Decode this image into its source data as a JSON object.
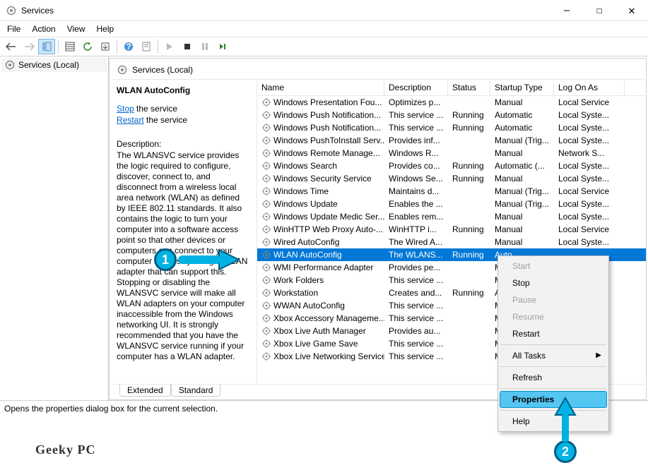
{
  "window": {
    "title": "Services"
  },
  "menubar": [
    "File",
    "Action",
    "View",
    "Help"
  ],
  "nav": {
    "root": "Services (Local)"
  },
  "detail_header": "Services (Local)",
  "selected_service": {
    "name": "WLAN AutoConfig",
    "actions": {
      "stop": "Stop",
      "stop_suffix": " the service",
      "restart": "Restart",
      "restart_suffix": " the service"
    },
    "desc_label": "Description:",
    "description": "The WLANSVC service provides the logic required to configure, discover, connect to, and disconnect from a wireless local area network (WLAN) as defined by IEEE 802.11 standards. It also contains the logic to turn your computer into a software access point so that other devices or computers can connect to your computer wirelessly using a WLAN adapter that can support this. Stopping or disabling the WLANSVC service will make all WLAN adapters on your computer inaccessible from the Windows networking UI. It is strongly recommended that you have the WLANSVC service running if your computer has a WLAN adapter."
  },
  "columns": {
    "name": "Name",
    "desc": "Description",
    "status": "Status",
    "start": "Startup Type",
    "logon": "Log On As"
  },
  "rows": [
    {
      "name": "Windows Presentation Fou...",
      "desc": "Optimizes p...",
      "status": "",
      "start": "Manual",
      "logon": "Local Service"
    },
    {
      "name": "Windows Push Notification...",
      "desc": "This service ...",
      "status": "Running",
      "start": "Automatic",
      "logon": "Local Syste..."
    },
    {
      "name": "Windows Push Notification...",
      "desc": "This service ...",
      "status": "Running",
      "start": "Automatic",
      "logon": "Local Syste..."
    },
    {
      "name": "Windows PushToInstall Serv...",
      "desc": "Provides inf...",
      "status": "",
      "start": "Manual (Trig...",
      "logon": "Local Syste..."
    },
    {
      "name": "Windows Remote Manage...",
      "desc": "Windows R...",
      "status": "",
      "start": "Manual",
      "logon": "Network S..."
    },
    {
      "name": "Windows Search",
      "desc": "Provides co...",
      "status": "Running",
      "start": "Automatic (...",
      "logon": "Local Syste..."
    },
    {
      "name": "Windows Security Service",
      "desc": "Windows Se...",
      "status": "Running",
      "start": "Manual",
      "logon": "Local Syste..."
    },
    {
      "name": "Windows Time",
      "desc": "Maintains d...",
      "status": "",
      "start": "Manual (Trig...",
      "logon": "Local Service"
    },
    {
      "name": "Windows Update",
      "desc": "Enables the ...",
      "status": "",
      "start": "Manual (Trig...",
      "logon": "Local Syste..."
    },
    {
      "name": "Windows Update Medic Ser...",
      "desc": "Enables rem...",
      "status": "",
      "start": "Manual",
      "logon": "Local Syste..."
    },
    {
      "name": "WinHTTP Web Proxy Auto-...",
      "desc": "WinHTTP i...",
      "status": "Running",
      "start": "Manual",
      "logon": "Local Service"
    },
    {
      "name": "Wired AutoConfig",
      "desc": "The Wired A...",
      "status": "",
      "start": "Manual",
      "logon": "Local Syste..."
    },
    {
      "name": "WLAN AutoConfig",
      "desc": "The WLANS...",
      "status": "Running",
      "start": "Auto",
      "logon": "",
      "selected": true
    },
    {
      "name": "WMI Performance Adapter",
      "desc": "Provides pe...",
      "status": "",
      "start": "Manu",
      "logon": ""
    },
    {
      "name": "Work Folders",
      "desc": "This service ...",
      "status": "",
      "start": "Manu",
      "logon": ""
    },
    {
      "name": "Workstation",
      "desc": "Creates and...",
      "status": "Running",
      "start": "Auto",
      "logon": ""
    },
    {
      "name": "WWAN AutoConfig",
      "desc": "This service ...",
      "status": "",
      "start": "Manu",
      "logon": ""
    },
    {
      "name": "Xbox Accessory Manageme...",
      "desc": "This service ...",
      "status": "",
      "start": "Manu",
      "logon": ""
    },
    {
      "name": "Xbox Live Auth Manager",
      "desc": "Provides au...",
      "status": "",
      "start": "Manu",
      "logon": ""
    },
    {
      "name": "Xbox Live Game Save",
      "desc": "This service ...",
      "status": "",
      "start": "Manu",
      "logon": ""
    },
    {
      "name": "Xbox Live Networking Service",
      "desc": "This service ...",
      "status": "",
      "start": "Manu",
      "logon": ""
    }
  ],
  "tabs": {
    "extended": "Extended",
    "standard": "Standard"
  },
  "statusbar": "Opens the properties dialog box for the current selection.",
  "context_menu": {
    "start": "Start",
    "stop": "Stop",
    "pause": "Pause",
    "resume": "Resume",
    "restart": "Restart",
    "all_tasks": "All Tasks",
    "refresh": "Refresh",
    "properties": "Properties",
    "help": "Help"
  },
  "annotations": {
    "one": "1",
    "two": "2"
  },
  "watermark": "Geeky PC"
}
